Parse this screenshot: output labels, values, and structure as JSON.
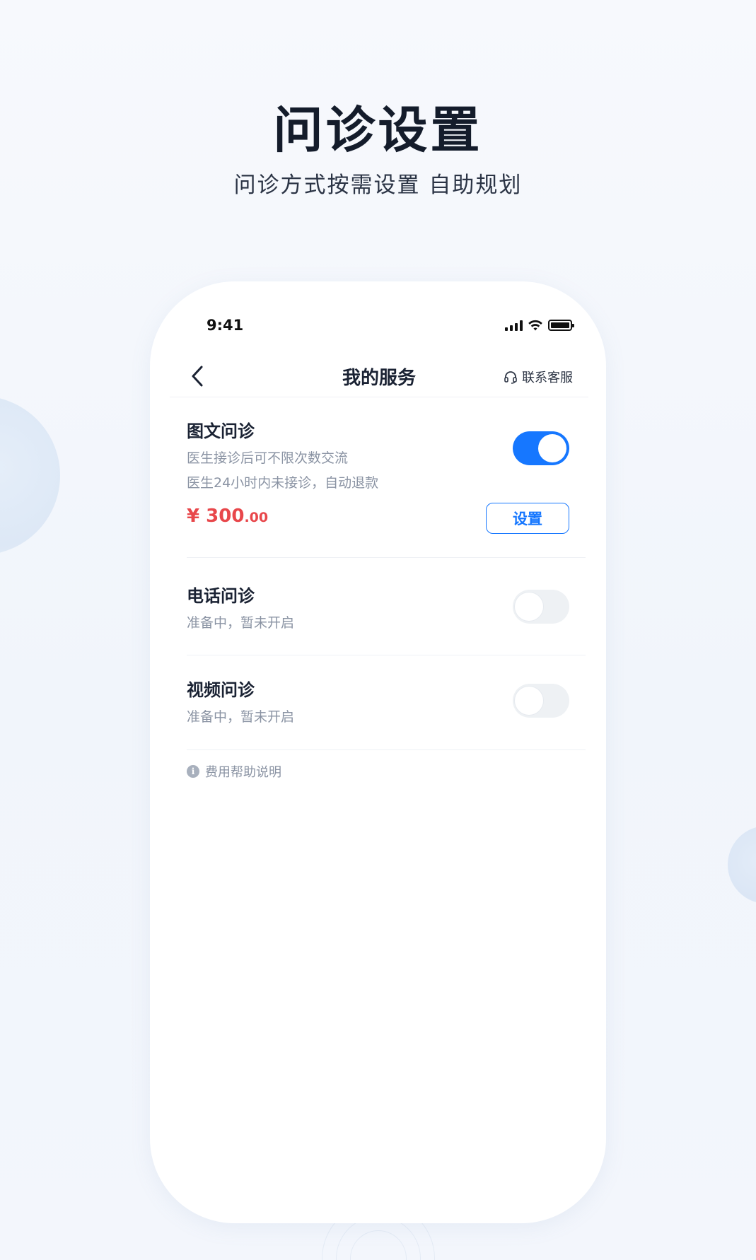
{
  "hero": {
    "title": "问诊设置",
    "subtitle": "问诊方式按需设置 自助规划"
  },
  "statusbar": {
    "time": "9:41",
    "icons": [
      "signal-icon",
      "wifi-icon",
      "battery-icon"
    ]
  },
  "navbar": {
    "back_icon": "chevron-left-icon",
    "title": "我的服务",
    "support_icon": "headset-icon",
    "support_label": "联系客服"
  },
  "services": [
    {
      "name": "图文问诊",
      "desc_lines": [
        "医生接诊后可不限次数交流",
        "医生24小时内未接诊，自动退款"
      ],
      "price_symbol": "¥",
      "price_int": "300",
      "price_dec": ".00",
      "enabled": true,
      "action_label": "设置"
    },
    {
      "name": "电话问诊",
      "desc_lines": [
        "准备中，暂未开启"
      ],
      "enabled": false
    },
    {
      "name": "视频问诊",
      "desc_lines": [
        "准备中，暂未开启"
      ],
      "enabled": false
    }
  ],
  "help": {
    "icon": "info-icon",
    "label": "费用帮助说明"
  },
  "colors": {
    "accent": "#1677ff",
    "price": "#e8474b",
    "muted_text": "#8a93a3",
    "toggle_off": "#eef1f4"
  }
}
